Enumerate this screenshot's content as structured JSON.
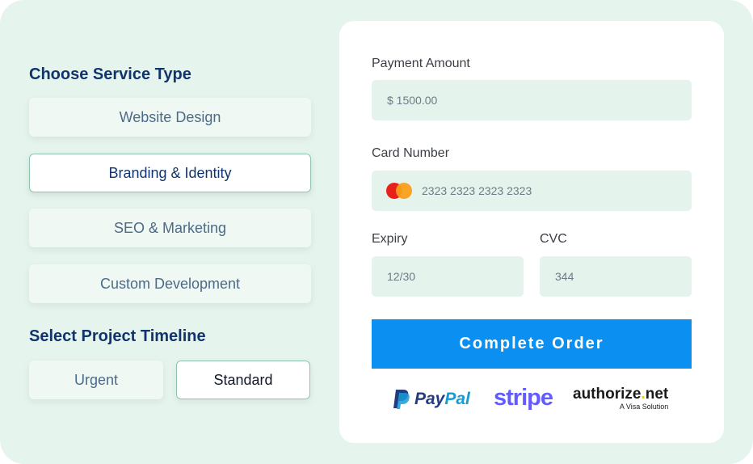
{
  "service": {
    "title": "Choose Service Type",
    "options": [
      {
        "label": "Website Design",
        "selected": false
      },
      {
        "label": "Branding & Identity",
        "selected": true
      },
      {
        "label": "SEO & Marketing",
        "selected": false
      },
      {
        "label": "Custom Development",
        "selected": false
      }
    ]
  },
  "timeline": {
    "title": "Select Project Timeline",
    "options": [
      {
        "label": "Urgent",
        "selected": false
      },
      {
        "label": "Standard",
        "selected": true
      }
    ]
  },
  "payment": {
    "amount_label": "Payment Amount",
    "amount_value": "$ 1500.00",
    "card_label": "Card Number",
    "card_value": "2323 2323 2323 2323",
    "expiry_label": "Expiry",
    "expiry_value": "12/30",
    "cvc_label": "CVC",
    "cvc_value": "344",
    "submit_label": "Complete Order"
  },
  "logos": {
    "paypal": {
      "pay": "Pay",
      "pal": "Pal"
    },
    "stripe": "stripe",
    "authorize": {
      "name_a": "authorize",
      "dot": ".",
      "name_b": "net",
      "tagline": "A Visa Solution"
    }
  },
  "colors": {
    "background": "#e6f4ee",
    "primary_button": "#0b8ff0",
    "heading": "#10346b",
    "paypal_dark": "#253b80",
    "paypal_light": "#179bd7",
    "stripe": "#635bff",
    "authorize_dot": "#f5c518"
  },
  "icons": {
    "card_brand": "mastercard-icon",
    "paypal": "paypal-logo",
    "stripe": "stripe-logo",
    "authorize": "authorize-net-logo"
  }
}
